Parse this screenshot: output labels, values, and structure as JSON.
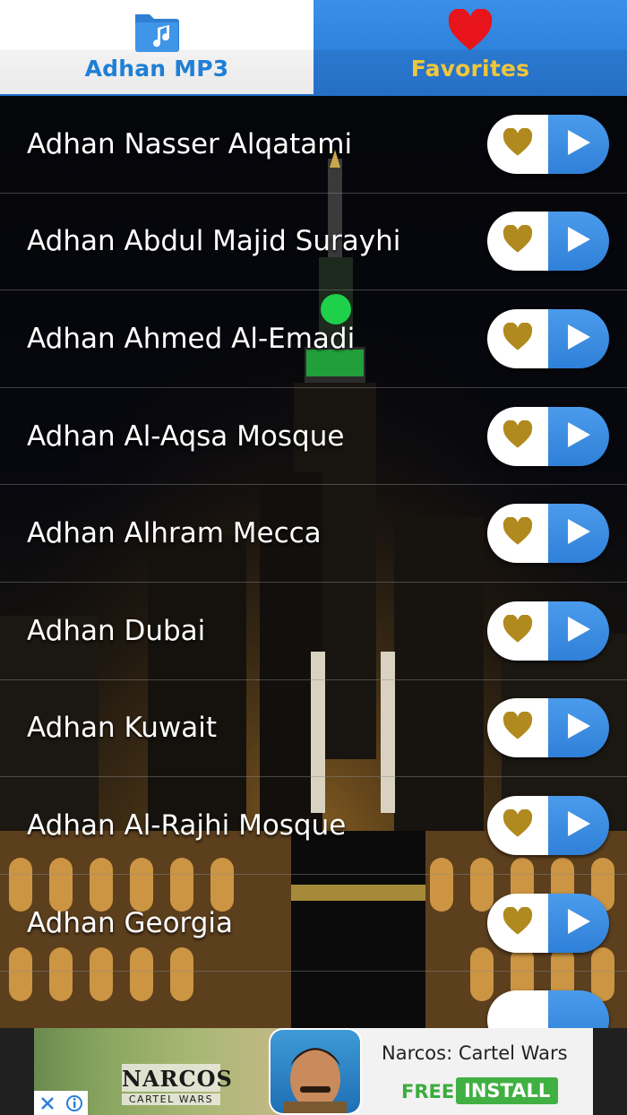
{
  "tabs": [
    {
      "label": "Adhan MP3",
      "icon": "folder-music-icon",
      "color": "#1f7fd6"
    },
    {
      "label": "Favorites",
      "icon": "heart-icon",
      "color": "#f0c63a"
    }
  ],
  "items": [
    {
      "title": "Adhan Nasser Alqatami"
    },
    {
      "title": "Adhan Abdul Majid Surayhi"
    },
    {
      "title": "Adhan Ahmed Al-Emadi"
    },
    {
      "title": "Adhan Al-Aqsa Mosque"
    },
    {
      "title": "Adhan Alhram Mecca"
    },
    {
      "title": "Adhan Dubai"
    },
    {
      "title": "Adhan Kuwait"
    },
    {
      "title": "Adhan Al-Rajhi Mosque"
    },
    {
      "title": "Adhan Georgia"
    }
  ],
  "ad": {
    "brand": "NARCOS",
    "brand_sub": "CARTEL WARS",
    "title": "Narcos: Cartel Wars",
    "free": "FREE",
    "install": "INSTALL"
  },
  "colors": {
    "accent_blue": "#2f80d8",
    "heart_gold": "#b08a1e",
    "favorites_heart": "#e8141c"
  }
}
